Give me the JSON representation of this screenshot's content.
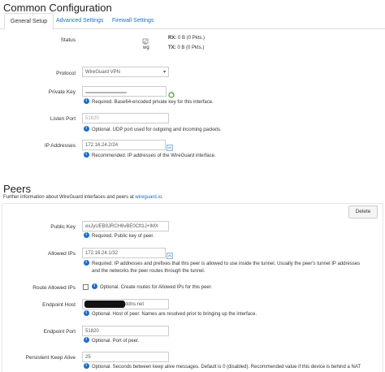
{
  "page_title": "Common Configuration",
  "tabs": [
    "General Setup",
    "Advanced Settings",
    "Firewall Settings"
  ],
  "status": {
    "label": "Status",
    "iface": "wg",
    "rx_label": "RX:",
    "rx_value": "0 B (0 Pkts.)",
    "tx_label": "TX:",
    "tx_value": "0 B (0 Pkts.)"
  },
  "protocol": {
    "label": "Protocol",
    "value": "WireGuard VPN"
  },
  "private_key": {
    "label": "Private Key",
    "value": "••••••••••••••••••••••••••••••••••••••••••••••••••••••••",
    "hint": "Required. Base64-encoded private key for this interface."
  },
  "listen_port": {
    "label": "Listen Port",
    "placeholder": "51820",
    "hint": "Optional. UDP port used for outgoing and incoming packets."
  },
  "ip_addresses": {
    "label": "IP Addresses",
    "value": "172.16.24.2/24",
    "hint": "Recommended. IP addresses of the WireGuard interface."
  },
  "peers": {
    "title": "Peers",
    "desc_prefix": "Further information about WireGuard interfaces and peers at ",
    "desc_link": "wireguard.io",
    "desc_suffix": ".",
    "delete_label": "Delete",
    "public_key": {
      "label": "Public Key",
      "value": "exJyUEB9JRCH6vBE0Cft1J+IMX",
      "hint": "Required. Public key of peer."
    },
    "allowed_ips": {
      "label": "Allowed IPs",
      "value": "172.16.24.1/32",
      "hint_line1": "Required. IP addresses and prefixes that this peer is allowed to use inside the tunnel. Usually the peer's tunnel IP addresses",
      "hint_line2": "and the networks the peer routes through the tunnel."
    },
    "route_allowed_ips": {
      "label": "Route Allowed IPs",
      "hint": "Optional. Create routes for Allowed IPs for this peer."
    },
    "endpoint_host": {
      "label": "Endpoint Host",
      "value_suffix": "ddns.net",
      "hint": "Optional. Host of peer. Names are resolved prior to bringing up the interface."
    },
    "endpoint_port": {
      "label": "Endpoint Port",
      "value": "51820",
      "hint": "Optional. Port of peer."
    },
    "keep_alive": {
      "label": "Persistent Keep Alive",
      "value": "25",
      "hint": "Optional. Seconds between keep alive messages. Default is 0 (disabled). Recommended value if this device is behind a NAT"
    }
  }
}
